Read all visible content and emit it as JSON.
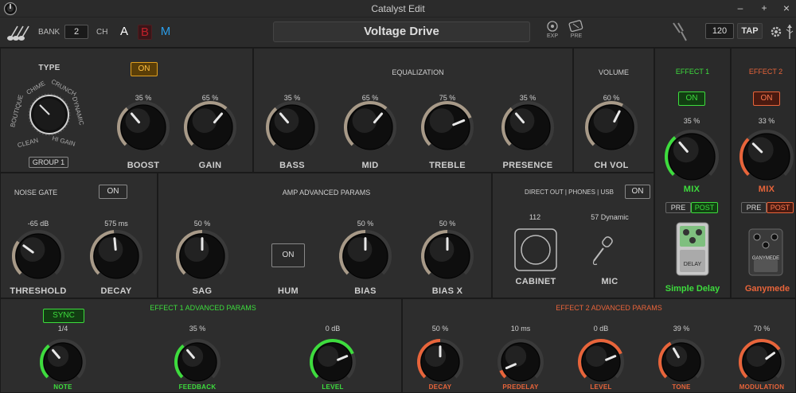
{
  "window": {
    "title": "Catalyst Edit",
    "min": "–",
    "max": "+",
    "close": "×"
  },
  "topbar": {
    "bank_label": "BANK",
    "bank_value": "2",
    "ch_label": "CH",
    "ch_a": "A",
    "ch_b": "B",
    "ch_m": "M",
    "preset_name": "Voltage Drive",
    "exp_label": "EXP",
    "pre_label": "PRE",
    "tempo": "120",
    "tap": "TAP"
  },
  "type_panel": {
    "title": "TYPE",
    "group": "GROUP 1",
    "types": [
      "CLEAN",
      "BOUTIQUE",
      "CHIME",
      "CRUNCH",
      "DYNAMIC",
      "HI GAIN"
    ],
    "boost_on": "ON"
  },
  "knobs": {
    "boost": {
      "label": "BOOST",
      "value": "35 %",
      "level": 0.35
    },
    "gain": {
      "label": "GAIN",
      "value": "65 %",
      "level": 0.65
    },
    "bass": {
      "label": "BASS",
      "value": "35 %",
      "level": 0.35
    },
    "mid": {
      "label": "MID",
      "value": "65 %",
      "level": 0.65
    },
    "treble": {
      "label": "TREBLE",
      "value": "75 %",
      "level": 0.75
    },
    "presence": {
      "label": "PRESENCE",
      "value": "35 %",
      "level": 0.35
    },
    "chvol": {
      "label": "CH VOL",
      "value": "60 %",
      "level": 0.6
    },
    "mix1": {
      "label": "MIX",
      "value": "35 %",
      "level": 0.35
    },
    "mix2": {
      "label": "MIX",
      "value": "33 %",
      "level": 0.33
    },
    "threshold": {
      "label": "THRESHOLD",
      "value": "-65 dB",
      "level": 0.3
    },
    "decay": {
      "label": "DECAY",
      "value": "575 ms",
      "level": 0.48
    },
    "sag": {
      "label": "SAG",
      "value": "50 %",
      "level": 0.5
    },
    "bias": {
      "label": "BIAS",
      "value": "50 %",
      "level": 0.5
    },
    "biasx": {
      "label": "BIAS X",
      "value": "50 %",
      "level": 0.5
    },
    "note": {
      "label": "NOTE",
      "value": "1/4",
      "level": 0.35
    },
    "feedback": {
      "label": "FEEDBACK",
      "value": "35 %",
      "level": 0.35
    },
    "level1": {
      "label": "LEVEL",
      "value": "0 dB",
      "level": 0.75
    },
    "decay2": {
      "label": "DECAY",
      "value": "50 %",
      "level": 0.5
    },
    "predelay": {
      "label": "PREDELAY",
      "value": "10 ms",
      "level": 0.08
    },
    "level2": {
      "label": "LEVEL",
      "value": "0 dB",
      "level": 0.75
    },
    "tone": {
      "label": "TONE",
      "value": "39 %",
      "level": 0.39
    },
    "modulation": {
      "label": "MODULATION",
      "value": "70 %",
      "level": 0.7
    }
  },
  "sections": {
    "eq": "EQUALIZATION",
    "volume": "VOLUME",
    "effect1": "EFFECT 1",
    "effect2": "EFFECT 2",
    "noise_gate": "NOISE GATE",
    "amp_adv": "AMP ADVANCED PARAMS",
    "direct_out": "DIRECT OUT | PHONES | USB",
    "fx1_adv": "EFFECT 1 ADVANCED PARAMS",
    "fx2_adv": "EFFECT 2 ADVANCED PARAMS"
  },
  "buttons": {
    "on": "ON",
    "pre": "PRE",
    "post": "POST",
    "sync": "SYNC",
    "hum": "HUM"
  },
  "cabinet": {
    "value": "112",
    "label": "CABINET"
  },
  "mic": {
    "value": "57 Dynamic",
    "label": "MIC"
  },
  "effects": {
    "effect1_name": "Simple Delay",
    "effect2_name": "Ganymede",
    "pedal1_text": "DELAY",
    "pedal2_text": "GANYMEDE"
  },
  "colors": {
    "accent_green": "#3ddc3d",
    "accent_orange": "#e8643a",
    "boost_amber": "#e0a020",
    "ch_b": "#c0202a",
    "ch_m": "#2a9ce8"
  }
}
